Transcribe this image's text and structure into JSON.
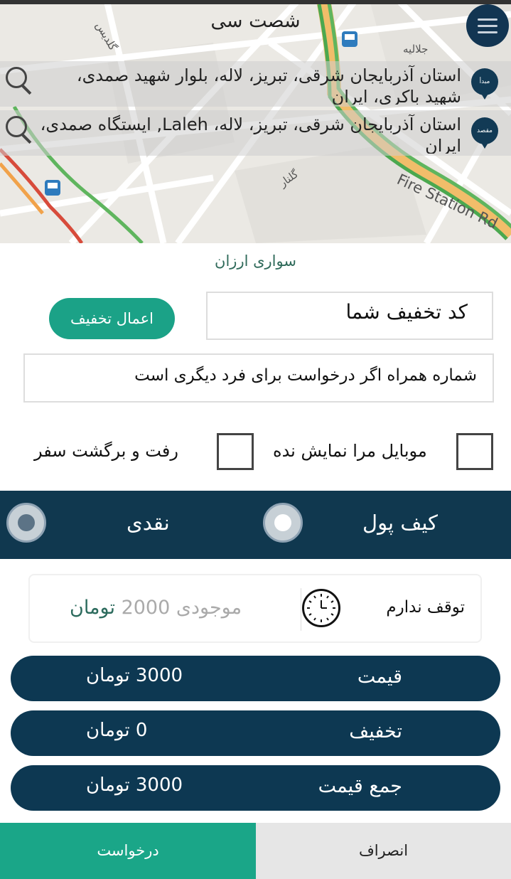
{
  "header": {
    "title": "شصت سی"
  },
  "map": {
    "labels": [
      "جلالیه",
      "گلدیس",
      "گلنار",
      "Fire Station Rd"
    ],
    "origin": {
      "marker": "مبدأ",
      "address": "استان آذربایجان شرقی، تبریز، لاله، بلوار شهید صمدی، شهید باکری، ایران"
    },
    "destination": {
      "marker": "مقصد",
      "address": "استان آذربایجان شرقی، تبریز، لاله، Laleh, ایستگاه صمدی، ایران"
    }
  },
  "service": {
    "name": "سواری ارزان"
  },
  "discount": {
    "placeholder": "کد تخفیف شما",
    "apply_label": "اعمال تخفیف"
  },
  "phone": {
    "placeholder": "شماره همراه اگر درخواست برای فرد دیگری است"
  },
  "options": {
    "hide_mobile": "موبایل مرا نمایش نده",
    "round_trip": "رفت و برگشت سفر"
  },
  "payment": {
    "wallet": "کیف پول",
    "cash": "نقدی",
    "selected": "wallet"
  },
  "info": {
    "no_stop": "توقف ندارم",
    "balance_label": "موجودی",
    "balance_value": "2000",
    "currency": "تومان"
  },
  "prices": {
    "price": {
      "label": "قیمت",
      "value": "3000 تومان"
    },
    "discount": {
      "label": "تخفیف",
      "value": "0 تومان"
    },
    "total": {
      "label": "جمع قیمت",
      "value": "3000 تومان"
    }
  },
  "actions": {
    "request": "درخواست",
    "cancel": "انصراف"
  },
  "colors": {
    "primary_dark": "#0d3852",
    "accent_green": "#1ba287"
  }
}
